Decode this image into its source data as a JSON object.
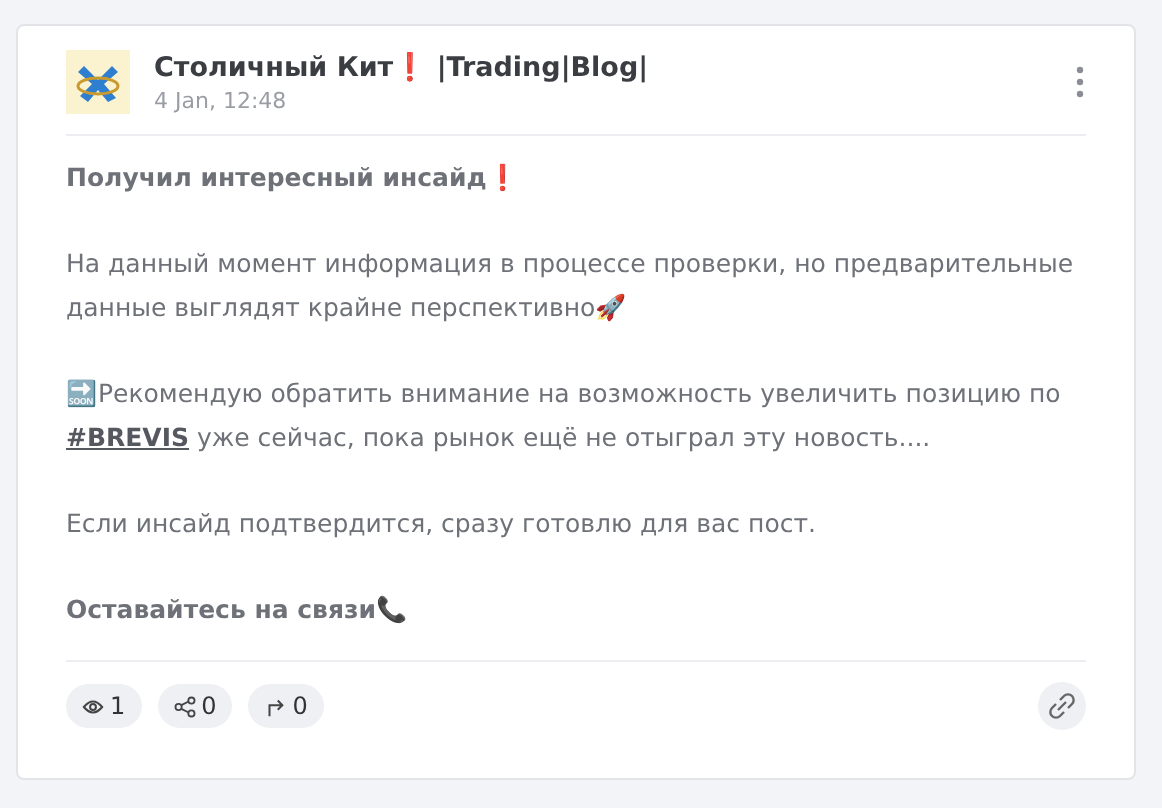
{
  "post": {
    "channel": "Столичный Кит❗ |Trading|Blog|",
    "time": "4 Jan, 12:48",
    "paragraphs": [
      {
        "kind": "bold",
        "text": "Получил интересный инсайд❗"
      },
      {
        "kind": "text",
        "text": "На данный момент информация в процессе проверки, но предварительные данные выглядят крайне перспективно🚀"
      },
      {
        "kind": "tagged",
        "before": "🔜Рекомендую обратить внимание на возможность увеличить позицию по ",
        "tag": "#BREVIS",
        "after": " уже сейчас, пока рынок ещё не отыграл эту новость...."
      },
      {
        "kind": "text",
        "text": "Если инсайд подтвердится, сразу готовлю для вас пост."
      },
      {
        "kind": "bold",
        "text": "Оставайтесь на связи📞"
      }
    ],
    "stats": [
      {
        "kind": "views",
        "count": "1"
      },
      {
        "kind": "shares",
        "count": "0"
      },
      {
        "kind": "forwards",
        "count": "0"
      }
    ]
  }
}
